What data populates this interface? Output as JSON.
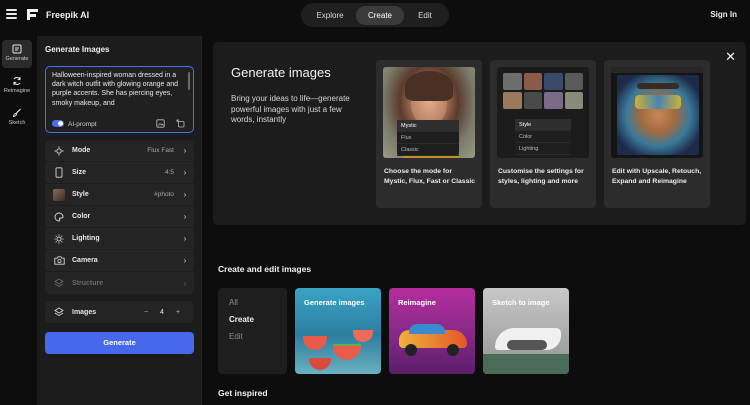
{
  "header": {
    "brand": "Freepik AI",
    "tabs": [
      {
        "label": "Explore",
        "active": false
      },
      {
        "label": "Create",
        "active": true
      },
      {
        "label": "Edit",
        "active": false
      }
    ],
    "signin": "Sign In"
  },
  "rail": {
    "items": [
      {
        "label": "Generate",
        "icon": "image-doc-icon",
        "active": true
      },
      {
        "label": "Reimagine",
        "icon": "refresh-icon",
        "active": false
      },
      {
        "label": "Sketch",
        "icon": "brush-icon",
        "active": false
      }
    ]
  },
  "panel": {
    "title": "Generate Images",
    "prompt": "Halloween-inspired woman dressed in a dark witch outfit with glowing orange and purple accents. She has piercing eyes, smoky makeup, and",
    "ai_prompt_label": "AI-prompt",
    "settings": [
      {
        "name": "Mode",
        "value": "Flux Fast",
        "icon": "sparkle-icon"
      },
      {
        "name": "Size",
        "value": "4:5",
        "icon": "phone-icon"
      },
      {
        "name": "Style",
        "value": "#photo",
        "icon": "avatar-thumb-icon"
      },
      {
        "name": "Color",
        "value": "",
        "icon": "palette-icon"
      },
      {
        "name": "Lighting",
        "value": "",
        "icon": "sun-icon"
      },
      {
        "name": "Camera",
        "value": "",
        "icon": "camera-icon"
      },
      {
        "name": "Structure",
        "value": "",
        "icon": "structure-icon"
      }
    ],
    "images_label": "Images",
    "images_count": "4",
    "minus": "−",
    "plus": "+",
    "generate_label": "Generate"
  },
  "hero": {
    "title": "Generate images",
    "subtitle": "Bring your ideas to life—generate powerful images with just a few words, instantly",
    "close": "✕",
    "cards": [
      {
        "caption": "Choose the mode for Mystic, Flux, Fast or Classic",
        "menu": [
          "Mystic",
          "Flux",
          "Classic"
        ]
      },
      {
        "caption": "Customise the settings for styles, lighting and more",
        "menu": [
          "Style",
          "Color",
          "Lighting"
        ]
      },
      {
        "caption": "Edit with Upscale, Retouch, Expand and Reimagine",
        "menu": []
      }
    ]
  },
  "create_section": {
    "title": "Create and edit images",
    "categories": [
      {
        "label": "All",
        "active": false
      },
      {
        "label": "Create",
        "active": true
      },
      {
        "label": "Edit",
        "active": false
      }
    ],
    "tiles": [
      {
        "label": "Generate images"
      },
      {
        "label": "Reimagine"
      },
      {
        "label": "Sketch to image"
      }
    ]
  },
  "inspired_title": "Get inspired",
  "colors": {
    "accent": "#4768ea",
    "background": "#0d0d0d",
    "panel": "#1c1c1c"
  }
}
